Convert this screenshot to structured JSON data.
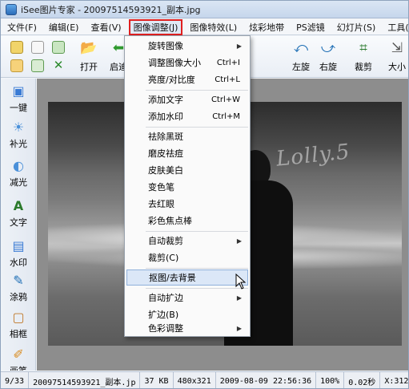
{
  "window": {
    "title": "iSee图片专家 - 20097514593921_副本.jpg"
  },
  "menubar": {
    "items": [
      {
        "label": "文件(F)"
      },
      {
        "label": "编辑(E)"
      },
      {
        "label": "查看(V)"
      },
      {
        "label": "图像调整(J)",
        "active": true
      },
      {
        "label": "图像特效(L)"
      },
      {
        "label": "炫彩地带"
      },
      {
        "label": "PS滤镜"
      },
      {
        "label": "幻灯片(S)"
      },
      {
        "label": "工具(T)"
      }
    ]
  },
  "toolbar": {
    "buttons": [
      {
        "label": "打开",
        "icon": "open-folder-icon"
      },
      {
        "label": "启迪",
        "icon": "back-arrow-icon"
      },
      {
        "label": "左旋",
        "icon": "rotate-left-icon"
      },
      {
        "label": "右旋",
        "icon": "rotate-right-icon"
      },
      {
        "label": "裁剪",
        "icon": "crop-icon"
      },
      {
        "label": "大小",
        "icon": "resize-icon"
      }
    ]
  },
  "sidebar": {
    "items": [
      {
        "label": "一键",
        "icon": "one-click-icon"
      },
      {
        "label": "补光",
        "icon": "fill-light-icon"
      },
      {
        "label": "减光",
        "icon": "reduce-light-icon"
      },
      {
        "label": "文字",
        "icon": "text-icon"
      },
      {
        "label": "水印",
        "icon": "watermark-icon"
      },
      {
        "label": "涂鸦",
        "icon": "doodle-icon"
      },
      {
        "label": "相框",
        "icon": "frame-icon"
      },
      {
        "label": "画笔",
        "icon": "brush-icon"
      }
    ]
  },
  "photo": {
    "watermark": "Lolly.5"
  },
  "dropdown": {
    "items": [
      {
        "label": "旋转图像",
        "shortcut": "",
        "submenu": true
      },
      {
        "label": "调整图像大小",
        "shortcut": "Ctrl+I",
        "submenu": false
      },
      {
        "label": "亮度/对比度",
        "shortcut": "Ctrl+L",
        "submenu": false
      },
      {
        "label": "添加文字",
        "shortcut": "Ctrl+W",
        "submenu": false
      },
      {
        "label": "添加水印",
        "shortcut": "Ctrl+M",
        "submenu": false
      },
      {
        "label": "祛除黑斑",
        "shortcut": "",
        "submenu": false
      },
      {
        "label": "磨皮祛痘",
        "shortcut": "",
        "submenu": false
      },
      {
        "label": "皮肤美白",
        "shortcut": "",
        "submenu": false
      },
      {
        "label": "变色笔",
        "shortcut": "",
        "submenu": false
      },
      {
        "label": "去红眼",
        "shortcut": "",
        "submenu": false
      },
      {
        "label": "彩色焦点棒",
        "shortcut": "",
        "submenu": false
      },
      {
        "label": "自动裁剪",
        "shortcut": "",
        "submenu": true
      },
      {
        "label": "裁剪(C)",
        "shortcut": "",
        "submenu": false
      },
      {
        "label": "抠图/去背景",
        "shortcut": "",
        "submenu": false,
        "hovered": true
      },
      {
        "label": "自动扩边",
        "shortcut": "",
        "submenu": true
      },
      {
        "label": "扩边(B)",
        "shortcut": "",
        "submenu": false
      },
      {
        "label": "色彩调整",
        "shortcut": "",
        "submenu": true
      }
    ]
  },
  "statusbar": {
    "index": "9/33",
    "filename": "20097514593921_副本.jp",
    "filesize": "37 KB",
    "dimensions": "480x321",
    "datetime": "2009-08-09 22:56:36",
    "zoom": "100%",
    "load_time": "0.02秒",
    "coords": "X:312"
  }
}
